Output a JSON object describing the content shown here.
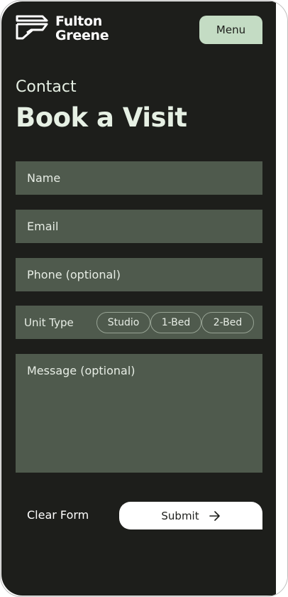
{
  "brand": {
    "line1": "Fulton",
    "line2": "Greene"
  },
  "header": {
    "menu_label": "Menu"
  },
  "hero": {
    "kicker": "Contact",
    "title": "Book a Visit"
  },
  "form": {
    "name_placeholder": "Name",
    "email_placeholder": "Email",
    "phone_placeholder": "Phone (optional)",
    "unit_type_label": "Unit Type",
    "unit_options": [
      "Studio",
      "1-Bed",
      "2-Bed"
    ],
    "message_placeholder": "Message (optional)",
    "clear_label": "Clear Form",
    "submit_label": "Submit"
  },
  "colors": {
    "background": "#1d1e1b",
    "field": "#4f5a4d",
    "accent": "#c4dcc4",
    "heading": "#e6f0e4"
  },
  "icons": {
    "logo": "fulton-greene-logo-icon",
    "submit": "arrow-right-icon"
  }
}
